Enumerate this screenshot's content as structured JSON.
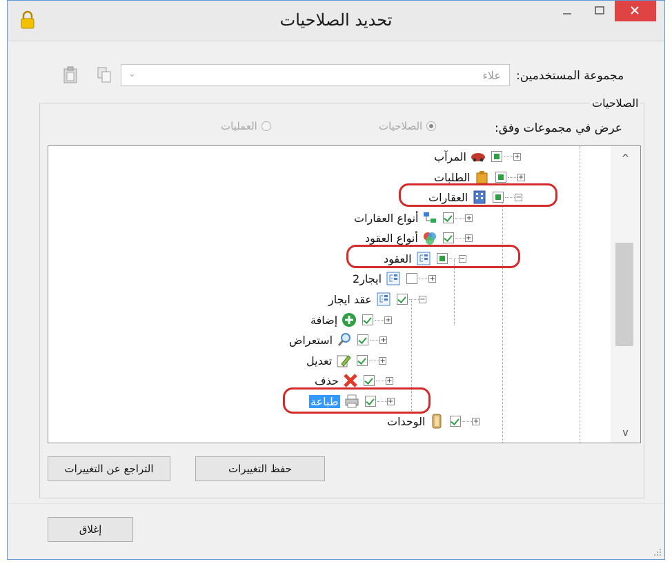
{
  "window": {
    "title": "تحديد الصلاحيات"
  },
  "titlebar": {
    "minimize_icon": "minimize-icon",
    "maximize_icon": "maximize-icon",
    "close_icon": "close-icon",
    "app_icon": "lock-icon"
  },
  "users_group": {
    "label": "مجموعة المستخدمين:",
    "value": "علاء",
    "arrow": "⌄"
  },
  "toolbar": {
    "icons": [
      "paste-icon",
      "copy-icon"
    ]
  },
  "permissions": {
    "group_title": "الصلاحيات",
    "view_by_label": "عرض في مجموعات وفق:",
    "radio_permissions": "الصلاحيات",
    "radio_operations": "العمليات",
    "selected": "الصلاحيات"
  },
  "tree": {
    "nodes": [
      {
        "label": "المرآب",
        "expander": "+",
        "check": "partial",
        "icon": "garage-icon"
      },
      {
        "label": "الطلبات",
        "expander": "+",
        "check": "partial",
        "icon": "orders-icon"
      },
      {
        "label": "العقارات",
        "expander": "−",
        "check": "partial",
        "icon": "building-icon"
      },
      {
        "label": "أنواع العقارات",
        "expander": "+",
        "check": "checked",
        "icon": "property-types-icon"
      },
      {
        "label": "أنواع العقود",
        "expander": "+",
        "check": "checked",
        "icon": "contract-types-icon"
      },
      {
        "label": "العقود",
        "expander": "−",
        "check": "partial",
        "icon": "contracts-icon"
      },
      {
        "label": "ايجار2",
        "expander": "+",
        "check": "none",
        "icon": "contracts-icon"
      },
      {
        "label": "عقد ايجار",
        "expander": "−",
        "check": "checked",
        "icon": "contracts-icon"
      },
      {
        "label": "إضافة",
        "expander": "+",
        "check": "checked",
        "icon": "add-icon"
      },
      {
        "label": "استعراض",
        "expander": "+",
        "check": "checked",
        "icon": "search-icon"
      },
      {
        "label": "تعديل",
        "expander": "+",
        "check": "checked",
        "icon": "edit-icon"
      },
      {
        "label": "حذف",
        "expander": "+",
        "check": "checked",
        "icon": "delete-icon"
      },
      {
        "label": "طباعة",
        "expander": "+",
        "check": "checked",
        "icon": "print-icon",
        "selected": true
      },
      {
        "label": "الوحدات",
        "expander": "+",
        "check": "checked",
        "icon": "units-icon"
      }
    ],
    "scroll_up": "^",
    "scroll_down": "v"
  },
  "buttons": {
    "save": "حفظ التغييرات",
    "revert": "التراجع عن التغييرات",
    "close": "إغلاق"
  },
  "colors": {
    "close_button": "#e04343",
    "highlight": "#3399ff",
    "annotation": "#d42a2a",
    "check": "#2ea043"
  }
}
